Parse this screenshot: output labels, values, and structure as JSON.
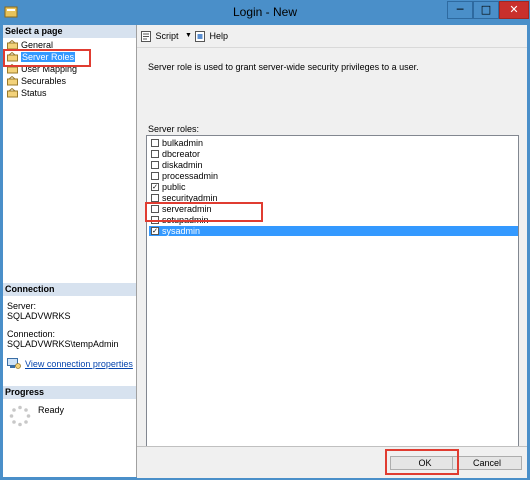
{
  "window": {
    "title": "Login - New",
    "controls": {
      "minimize": "─",
      "maximize": "□",
      "close": "✕"
    }
  },
  "sidebar": {
    "select_page_header": "Select a page",
    "pages": [
      {
        "label": "General",
        "selected": false
      },
      {
        "label": "Server Roles",
        "selected": true
      },
      {
        "label": "User Mapping",
        "selected": false
      },
      {
        "label": "Securables",
        "selected": false
      },
      {
        "label": "Status",
        "selected": false
      }
    ],
    "connection_header": "Connection",
    "server_label": "Server:",
    "server_value": "SQLADVWRKS",
    "connection_label": "Connection:",
    "connection_value": "SQLADVWRKS\\tempAdmin",
    "view_connection_link": "View connection properties",
    "progress_header": "Progress",
    "progress_status": "Ready"
  },
  "toolbar": {
    "script_label": "Script",
    "script_dropdown": "▼",
    "help_label": "Help"
  },
  "main": {
    "description": "Server role is used to grant server-wide security privileges to a user.",
    "roles_label": "Server roles:",
    "roles": [
      {
        "label": "bulkadmin",
        "checked": false,
        "selected": false
      },
      {
        "label": "dbcreator",
        "checked": false,
        "selected": false
      },
      {
        "label": "diskadmin",
        "checked": false,
        "selected": false
      },
      {
        "label": "processadmin",
        "checked": false,
        "selected": false
      },
      {
        "label": "public",
        "checked": true,
        "selected": false
      },
      {
        "label": "securityadmin",
        "checked": false,
        "selected": false
      },
      {
        "label": "serveradmin",
        "checked": false,
        "selected": false
      },
      {
        "label": "setupadmin",
        "checked": false,
        "selected": false
      },
      {
        "label": "sysadmin",
        "checked": true,
        "selected": true
      }
    ]
  },
  "buttons": {
    "ok": "OK",
    "cancel": "Cancel"
  },
  "colors": {
    "titlebar": "#4a8fc9",
    "selection": "#3399ff",
    "annotation_red": "#e03c31",
    "section_header": "#d7e2ef",
    "link": "#0645ad"
  }
}
